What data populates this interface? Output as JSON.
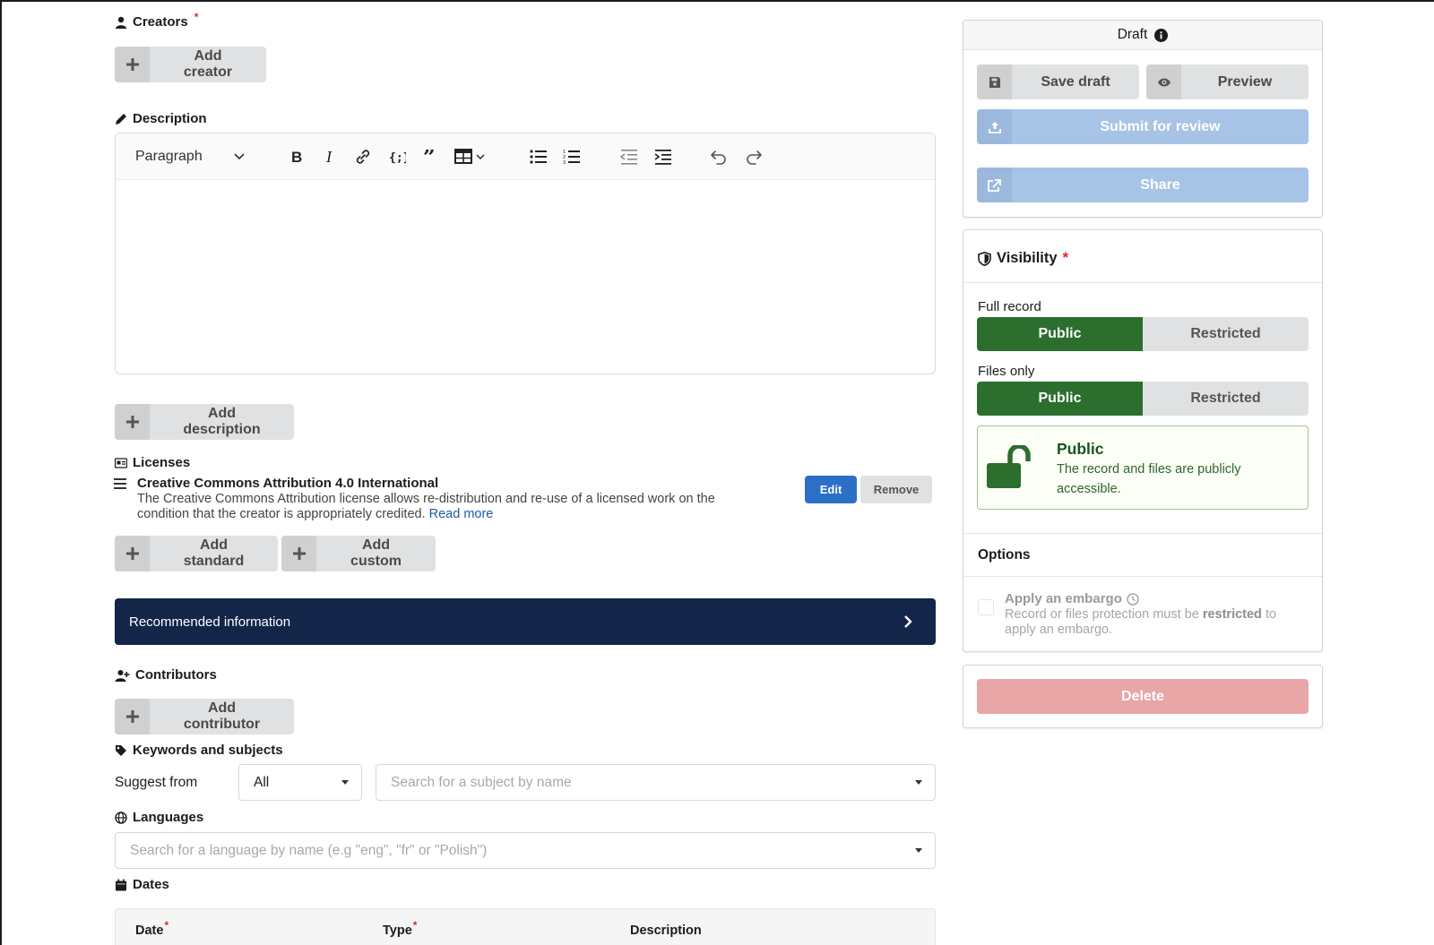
{
  "form": {
    "creators": {
      "label": "Creators",
      "required_mark": "*",
      "add_button": "Add creator"
    },
    "description": {
      "label": "Description",
      "format_select": "Paragraph",
      "add_button": "Add description"
    },
    "licenses": {
      "label": "Licenses",
      "item": {
        "title": "Creative Commons Attribution 4.0 International",
        "description": "The Creative Commons Attribution license allows re-distribution and re-use of a licensed work on the condition that the creator is appropriately credited.",
        "read_more": "Read more",
        "edit_label": "Edit",
        "remove_label": "Remove"
      },
      "add_standard": "Add standard",
      "add_custom": "Add custom"
    },
    "recommended": {
      "label": "Recommended information"
    },
    "contributors": {
      "label": "Contributors",
      "add_button": "Add contributor"
    },
    "keywords": {
      "label": "Keywords and subjects",
      "suggest_label": "Suggest from",
      "suggest_value": "All",
      "search_placeholder": "Search for a subject by name"
    },
    "languages": {
      "label": "Languages",
      "search_placeholder": "Search for a language by name (e.g \"eng\", \"fr\" or \"Polish\")"
    },
    "dates": {
      "label": "Dates",
      "columns": [
        "Date",
        "Type",
        "Description"
      ],
      "required_mark": "*"
    }
  },
  "sidebar": {
    "status": {
      "label": "Draft"
    },
    "save_draft": "Save draft",
    "preview": "Preview",
    "submit": "Submit for review",
    "share": "Share",
    "visibility": {
      "title": "Visibility",
      "required_mark": "*",
      "full_record": {
        "label": "Full record",
        "options": [
          "Public",
          "Restricted"
        ],
        "selected": "Public"
      },
      "files_only": {
        "label": "Files only",
        "options": [
          "Public",
          "Restricted"
        ],
        "selected": "Public"
      },
      "notice": {
        "title": "Public",
        "text": "The record and files are publicly accessible."
      }
    },
    "options": {
      "title": "Options",
      "embargo_label": "Apply an embargo",
      "embargo_help_pre": "Record or files protection must be ",
      "embargo_help_bold": "restricted",
      "embargo_help_post": " to apply an embargo.",
      "embargo_checked": false
    },
    "delete": "Delete"
  },
  "colors": {
    "navy": "#14254a",
    "public_green": "#2c6e2d",
    "primary_blue": "#2b6fc7",
    "disabled_blue": "#a7c3e6",
    "delete_disabled": "#e8a6a6",
    "required_red": "#db2828"
  }
}
